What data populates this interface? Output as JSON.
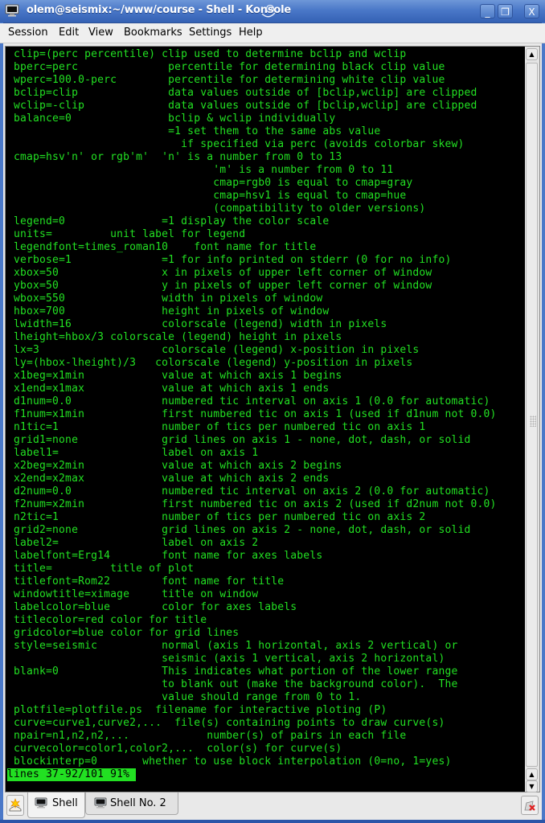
{
  "window": {
    "title": "olem@seismix:~/www/course - Shell - Konsole",
    "icon": "terminal-icon",
    "controls": {
      "minimize": "_",
      "maximize": "❐",
      "close": "X"
    }
  },
  "menubar": {
    "items": [
      "Session",
      "Edit",
      "View",
      "Bookmarks",
      "Settings",
      "Help"
    ]
  },
  "terminal": {
    "text_color": "#22e022",
    "background": "#000000",
    "lines": [
      " clip=(perc percentile) clip used to determine bclip and wclip",
      " bperc=perc              percentile for determining black clip value",
      " wperc=100.0-perc        percentile for determining white clip value",
      " bclip=clip              data values outside of [bclip,wclip] are clipped",
      " wclip=-clip             data values outside of [bclip,wclip] are clipped",
      " balance=0               bclip & wclip individually",
      "                         =1 set them to the same abs value",
      "                           if specified via perc (avoids colorbar skew)",
      " cmap=hsv'n' or rgb'm'  'n' is a number from 0 to 13",
      "                                'm' is a number from 0 to 11",
      "                                cmap=rgb0 is equal to cmap=gray",
      "                                cmap=hsv1 is equal to cmap=hue",
      "                                (compatibility to older versions)",
      " legend=0               =1 display the color scale",
      " units=         unit label for legend",
      " legendfont=times_roman10    font name for title",
      " verbose=1              =1 for info printed on stderr (0 for no info)",
      " xbox=50                x in pixels of upper left corner of window",
      " ybox=50                y in pixels of upper left corner of window",
      " wbox=550               width in pixels of window",
      " hbox=700               height in pixels of window",
      " lwidth=16              colorscale (legend) width in pixels",
      " lheight=hbox/3 colorscale (legend) height in pixels",
      " lx=3                   colorscale (legend) x-position in pixels",
      " ly=(hbox-lheight)/3   colorscale (legend) y-position in pixels",
      " x1beg=x1min            value at which axis 1 begins",
      " x1end=x1max            value at which axis 1 ends",
      " d1num=0.0              numbered tic interval on axis 1 (0.0 for automatic)",
      " f1num=x1min            first numbered tic on axis 1 (used if d1num not 0.0)",
      " n1tic=1                number of tics per numbered tic on axis 1",
      " grid1=none             grid lines on axis 1 - none, dot, dash, or solid",
      " label1=                label on axis 1",
      " x2beg=x2min            value at which axis 2 begins",
      " x2end=x2max            value at which axis 2 ends",
      " d2num=0.0              numbered tic interval on axis 2 (0.0 for automatic)",
      " f2num=x2min            first numbered tic on axis 2 (used if d2num not 0.0)",
      " n2tic=1                number of tics per numbered tic on axis 2",
      " grid2=none             grid lines on axis 2 - none, dot, dash, or solid",
      " label2=                label on axis 2",
      " labelfont=Erg14        font name for axes labels",
      " title=         title of plot",
      " titlefont=Rom22        font name for title",
      " windowtitle=ximage     title on window",
      " labelcolor=blue        color for axes labels",
      " titlecolor=red color for title",
      " gridcolor=blue color for grid lines",
      " style=seismic          normal (axis 1 horizontal, axis 2 vertical) or",
      "                        seismic (axis 1 vertical, axis 2 horizontal)",
      " blank=0                This indicates what portion of the lower range",
      "                        to blank out (make the background color).  The",
      "                        value should range from 0 to 1.",
      " plotfile=plotfile.ps  filename for interactive ploting (P)",
      " curve=curve1,curve2,...  file(s) containing points to draw curve(s)",
      " npair=n1,n2,n2,...            number(s) of pairs in each file",
      " curvecolor=color1,color2,...  color(s) for curve(s)",
      " blockinterp=0       whether to use block interpolation (0=no, 1=yes)"
    ],
    "status_line": "lines 37-92/101 91% ",
    "scroll_position_percent": 91
  },
  "tabs": {
    "new_session_icon": "new-session-icon",
    "items": [
      {
        "label": "Shell",
        "active": true
      },
      {
        "label": "Shell No. 2",
        "active": false
      }
    ],
    "close_session_icon": "close-session-icon"
  }
}
